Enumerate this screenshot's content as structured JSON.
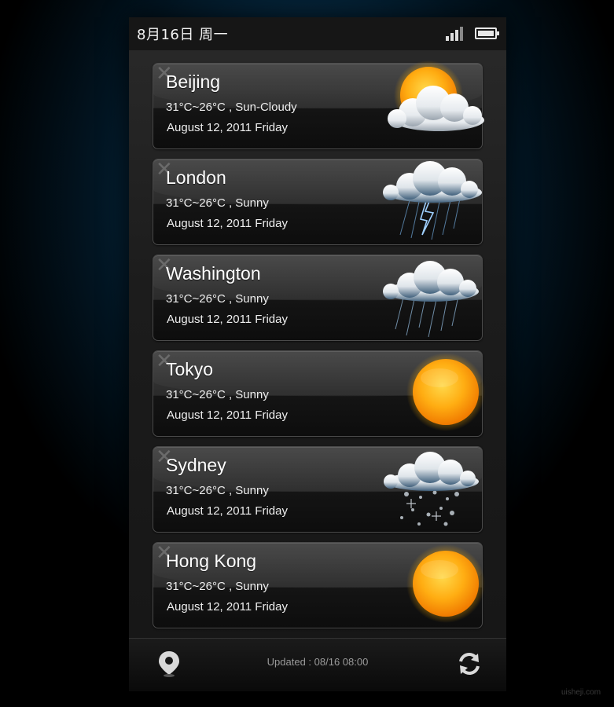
{
  "status_bar": {
    "date": "8月16日  周一",
    "signal_icon": "signal-icon",
    "battery_icon": "battery-icon"
  },
  "cities": [
    {
      "city": "Beijing",
      "temp": "31°C~26°C , Sun-Cloudy",
      "date": "August 12, 2011 Friday",
      "icon": "sun-cloudy-icon",
      "delete_icon": "delete-icon"
    },
    {
      "city": "London",
      "temp": "31°C~26°C , Sunny",
      "date": "August 12, 2011 Friday",
      "icon": "thunderstorm-icon",
      "delete_icon": "delete-icon"
    },
    {
      "city": "Washington",
      "temp": "31°C~26°C , Sunny",
      "date": "August 12, 2011 Friday",
      "icon": "rain-icon",
      "delete_icon": "delete-icon"
    },
    {
      "city": "Tokyo",
      "temp": "31°C~26°C , Sunny",
      "date": "August 12, 2011 Friday",
      "icon": "sun-icon",
      "delete_icon": "delete-icon"
    },
    {
      "city": "Sydney",
      "temp": "31°C~26°C , Sunny",
      "date": "August 12, 2011 Friday",
      "icon": "snow-icon",
      "delete_icon": "delete-icon"
    },
    {
      "city": "Hong Kong",
      "temp": "31°C~26°C , Sunny",
      "date": "August 12, 2011 Friday",
      "icon": "sun-icon",
      "delete_icon": "delete-icon"
    }
  ],
  "footer": {
    "updated": "Updated : 08/16 08:00",
    "location_icon": "location-pin-icon",
    "refresh_icon": "refresh-icon"
  },
  "watermark": "uisheji.com",
  "colors": {
    "background": "#062b44",
    "sun": "#ffa000",
    "card": "#2b2b2b"
  }
}
